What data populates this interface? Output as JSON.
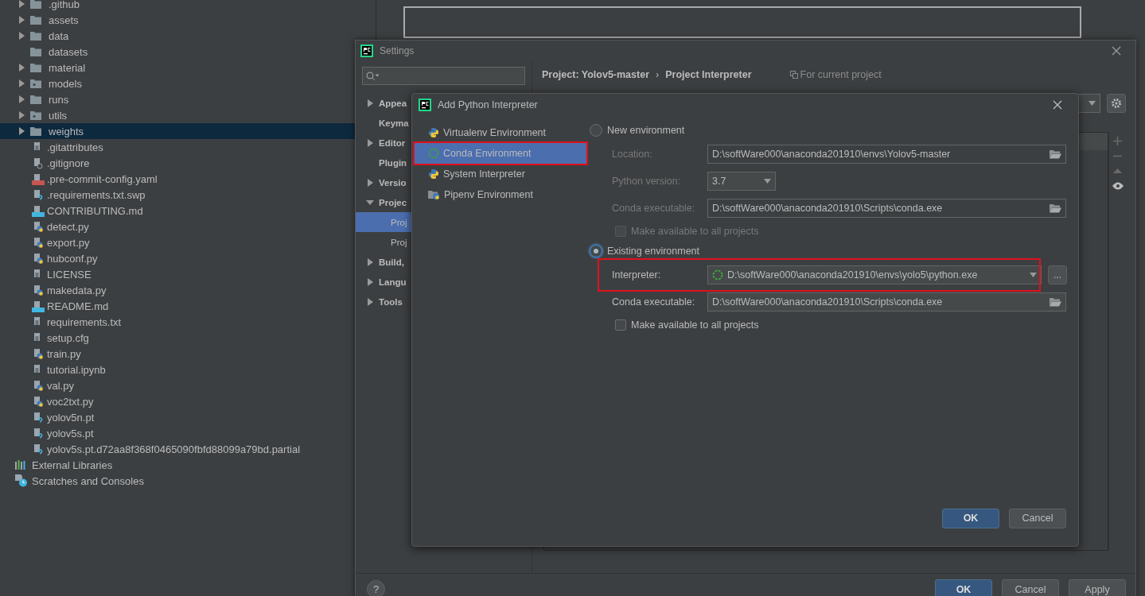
{
  "project_tree": [
    {
      "name": ".github",
      "kind": "folder",
      "expanded": false,
      "selected": false
    },
    {
      "name": "assets",
      "kind": "folder",
      "expanded": false,
      "selected": false
    },
    {
      "name": "data",
      "kind": "folder",
      "expanded": false,
      "selected": false
    },
    {
      "name": "datasets",
      "kind": "folder",
      "selected": false
    },
    {
      "name": "material",
      "kind": "folder",
      "expanded": false,
      "selected": false
    },
    {
      "name": "models",
      "kind": "package",
      "expanded": false,
      "selected": false
    },
    {
      "name": "runs",
      "kind": "folder",
      "expanded": false,
      "selected": false
    },
    {
      "name": "utils",
      "kind": "package",
      "expanded": false,
      "selected": false
    },
    {
      "name": "weights",
      "kind": "folder",
      "expanded": false,
      "selected": true
    },
    {
      "name": ".gitattributes",
      "kind": "text",
      "selected": false
    },
    {
      "name": ".gitignore",
      "kind": "ignore",
      "selected": false
    },
    {
      "name": ".pre-commit-config.yaml",
      "kind": "yaml",
      "selected": false
    },
    {
      "name": ".requirements.txt.swp",
      "kind": "unknown",
      "selected": false
    },
    {
      "name": "CONTRIBUTING.md",
      "kind": "markdown",
      "selected": false
    },
    {
      "name": "detect.py",
      "kind": "python",
      "selected": false
    },
    {
      "name": "export.py",
      "kind": "python",
      "selected": false
    },
    {
      "name": "hubconf.py",
      "kind": "python",
      "selected": false
    },
    {
      "name": "LICENSE",
      "kind": "text",
      "selected": false
    },
    {
      "name": "makedata.py",
      "kind": "python",
      "selected": false
    },
    {
      "name": "README.md",
      "kind": "markdown",
      "selected": false
    },
    {
      "name": "requirements.txt",
      "kind": "text",
      "selected": false
    },
    {
      "name": "setup.cfg",
      "kind": "text",
      "selected": false
    },
    {
      "name": "train.py",
      "kind": "python",
      "selected": false
    },
    {
      "name": "tutorial.ipynb",
      "kind": "text",
      "selected": false
    },
    {
      "name": "val.py",
      "kind": "python",
      "selected": false
    },
    {
      "name": "voc2txt.py",
      "kind": "python",
      "selected": false
    },
    {
      "name": "yolov5n.pt",
      "kind": "unknown",
      "selected": false
    },
    {
      "name": "yolov5s.pt",
      "kind": "unknown",
      "selected": false
    },
    {
      "name": "yolov5s.pt.d72aa8f368f0465090fbfd88099a79bd.partial",
      "kind": "unknown",
      "selected": false
    },
    {
      "name": "External Libraries",
      "kind": "libraries",
      "selected": false
    },
    {
      "name": "Scratches and Consoles",
      "kind": "scratches",
      "selected": false
    }
  ],
  "settings": {
    "title": "Settings",
    "sidebar": [
      {
        "label": "Appea",
        "expanded": false,
        "selected": false
      },
      {
        "label": "Keyma",
        "selected": false
      },
      {
        "label": "Editor",
        "expanded": false,
        "selected": false
      },
      {
        "label": "Plugin",
        "selected": false
      },
      {
        "label": "Versio",
        "expanded": false,
        "selected": false
      },
      {
        "label": "Projec",
        "expanded": true,
        "selected": false,
        "children": [
          {
            "label": "Proj",
            "selected": true
          },
          {
            "label": "Proj",
            "selected": false
          }
        ]
      },
      {
        "label": "Build,",
        "expanded": false,
        "selected": false
      },
      {
        "label": "Langu",
        "expanded": false,
        "selected": false
      },
      {
        "label": "Tools",
        "expanded": false,
        "selected": false
      }
    ],
    "breadcrumb": [
      "Project: Yolov5-master",
      "Project Interpreter"
    ],
    "breadcrumb_separator": "›",
    "scope_note": "For current project",
    "buttons": [
      {
        "label": "OK",
        "primary": true
      },
      {
        "label": "Cancel",
        "primary": false
      },
      {
        "label": "Apply",
        "primary": false
      }
    ],
    "help": "?"
  },
  "dialog": {
    "title": "Add Python Interpreter",
    "types": [
      {
        "label": "Virtualenv Environment",
        "kind": "python",
        "selected": false,
        "highlighted": false
      },
      {
        "label": "Conda Environment",
        "kind": "conda",
        "selected": true,
        "highlighted": true
      },
      {
        "label": "System Interpreter",
        "kind": "python",
        "selected": false,
        "highlighted": false
      },
      {
        "label": "Pipenv Environment",
        "kind": "pipenv",
        "selected": false,
        "highlighted": false
      }
    ],
    "new_environment": {
      "label": "New environment",
      "selected": false,
      "fields": [
        {
          "label": "Location:",
          "value": "D:\\softWare000\\anaconda201910\\envs\\Yolov5-master",
          "kind": "path"
        },
        {
          "label": "Python version:",
          "value": "3.7",
          "kind": "combo"
        },
        {
          "label": "Conda executable:",
          "value": "D:\\softWare000\\anaconda201910\\Scripts\\conda.exe",
          "kind": "path"
        }
      ],
      "make_available": {
        "label": "Make available to all projects",
        "checked": false,
        "disabled": true
      }
    },
    "existing_environment": {
      "label": "Existing environment",
      "selected": true,
      "fields": [
        {
          "label": "Interpreter:",
          "value": "D:\\softWare000\\anaconda201910\\envs\\yolo5\\python.exe",
          "kind": "interpreter",
          "highlighted": true,
          "browse": "..."
        },
        {
          "label": "Conda executable:",
          "value": "D:\\softWare000\\anaconda201910\\Scripts\\conda.exe",
          "kind": "path"
        }
      ],
      "make_available": {
        "label": "Make available to all projects",
        "checked": false,
        "disabled": false
      }
    },
    "buttons": [
      {
        "label": "OK",
        "primary": true
      },
      {
        "label": "Cancel",
        "primary": false
      }
    ]
  }
}
